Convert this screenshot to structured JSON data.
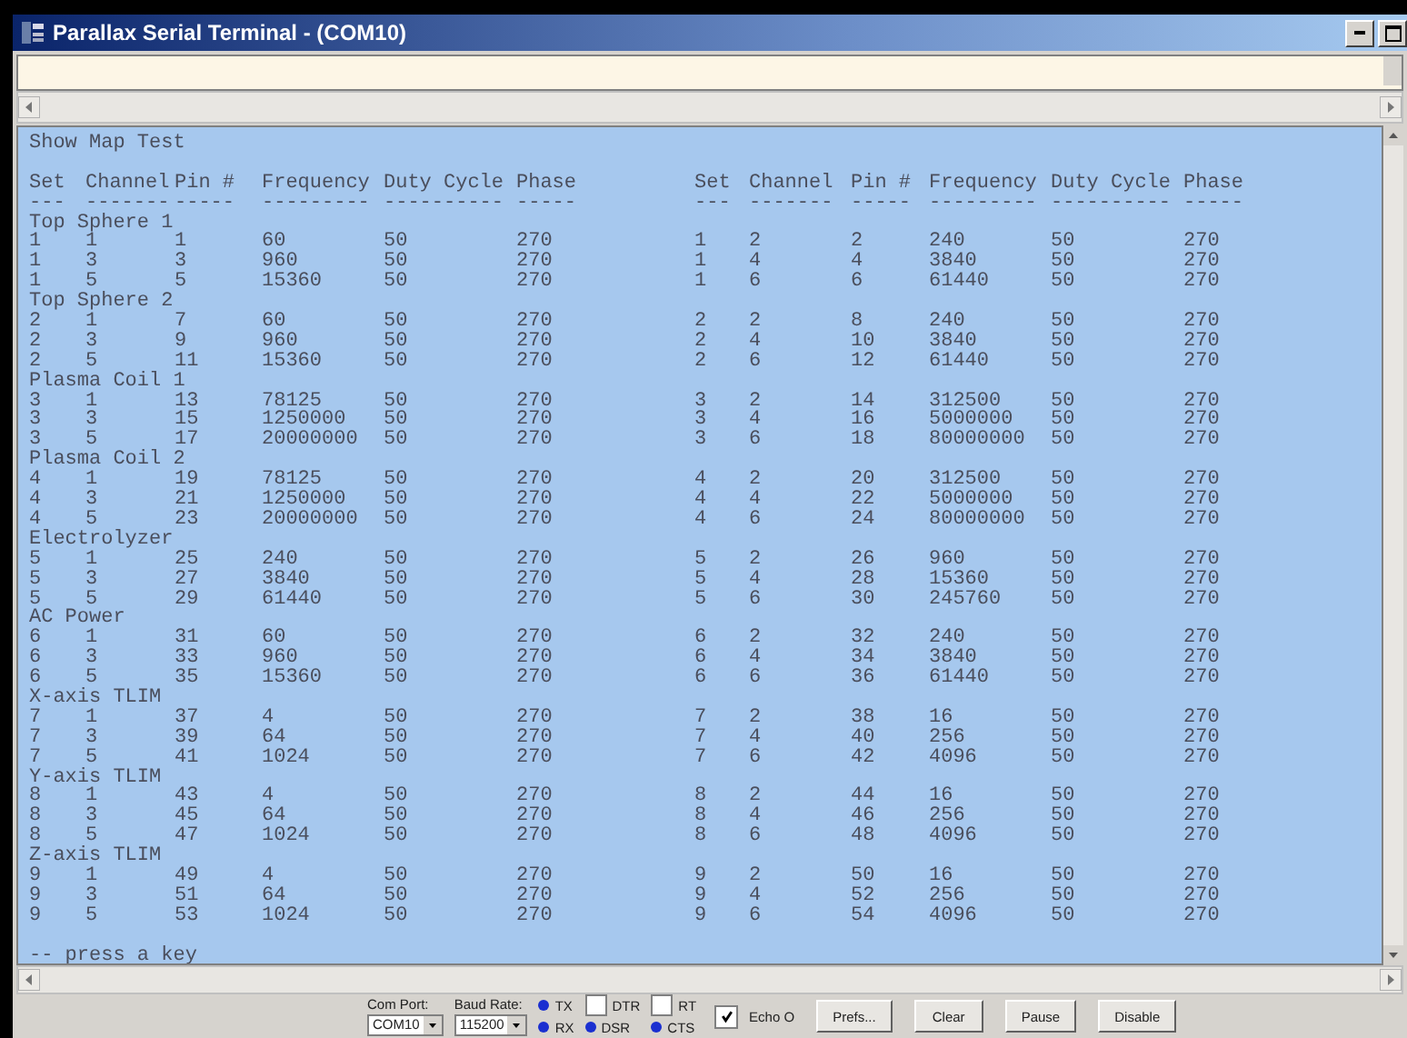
{
  "window": {
    "title": "Parallax Serial Terminal - (COM10)"
  },
  "terminal": {
    "heading": "Show Map Test",
    "columns": [
      "Set",
      "Channel",
      "Pin #",
      "Frequency",
      "Duty Cycle",
      "Phase",
      "Set",
      "Channel",
      "Pin #",
      "Frequency",
      "Duty Cycle",
      "Phase"
    ],
    "underlines": [
      "---",
      "-------",
      "-----",
      "---------",
      "----------",
      "-----",
      "---",
      "-------",
      "-----",
      "---------",
      "----------",
      "-----"
    ],
    "groups": [
      {
        "name": "Top Sphere 1",
        "rows": [
          [
            "1",
            "1",
            "1",
            "60",
            "50",
            "270",
            "1",
            "2",
            "2",
            "240",
            "50",
            "270"
          ],
          [
            "1",
            "3",
            "3",
            "960",
            "50",
            "270",
            "1",
            "4",
            "4",
            "3840",
            "50",
            "270"
          ],
          [
            "1",
            "5",
            "5",
            "15360",
            "50",
            "270",
            "1",
            "6",
            "6",
            "61440",
            "50",
            "270"
          ]
        ]
      },
      {
        "name": "Top Sphere 2",
        "rows": [
          [
            "2",
            "1",
            "7",
            "60",
            "50",
            "270",
            "2",
            "2",
            "8",
            "240",
            "50",
            "270"
          ],
          [
            "2",
            "3",
            "9",
            "960",
            "50",
            "270",
            "2",
            "4",
            "10",
            "3840",
            "50",
            "270"
          ],
          [
            "2",
            "5",
            "11",
            "15360",
            "50",
            "270",
            "2",
            "6",
            "12",
            "61440",
            "50",
            "270"
          ]
        ]
      },
      {
        "name": "Plasma Coil 1",
        "rows": [
          [
            "3",
            "1",
            "13",
            "78125",
            "50",
            "270",
            "3",
            "2",
            "14",
            "312500",
            "50",
            "270"
          ],
          [
            "3",
            "3",
            "15",
            "1250000",
            "50",
            "270",
            "3",
            "4",
            "16",
            "5000000",
            "50",
            "270"
          ],
          [
            "3",
            "5",
            "17",
            "20000000",
            "50",
            "270",
            "3",
            "6",
            "18",
            "80000000",
            "50",
            "270"
          ]
        ]
      },
      {
        "name": "Plasma Coil 2",
        "rows": [
          [
            "4",
            "1",
            "19",
            "78125",
            "50",
            "270",
            "4",
            "2",
            "20",
            "312500",
            "50",
            "270"
          ],
          [
            "4",
            "3",
            "21",
            "1250000",
            "50",
            "270",
            "4",
            "4",
            "22",
            "5000000",
            "50",
            "270"
          ],
          [
            "4",
            "5",
            "23",
            "20000000",
            "50",
            "270",
            "4",
            "6",
            "24",
            "80000000",
            "50",
            "270"
          ]
        ]
      },
      {
        "name": "Electrolyzer",
        "rows": [
          [
            "5",
            "1",
            "25",
            "240",
            "50",
            "270",
            "5",
            "2",
            "26",
            "960",
            "50",
            "270"
          ],
          [
            "5",
            "3",
            "27",
            "3840",
            "50",
            "270",
            "5",
            "4",
            "28",
            "15360",
            "50",
            "270"
          ],
          [
            "5",
            "5",
            "29",
            "61440",
            "50",
            "270",
            "5",
            "6",
            "30",
            "245760",
            "50",
            "270"
          ]
        ]
      },
      {
        "name": "AC Power",
        "rows": [
          [
            "6",
            "1",
            "31",
            "60",
            "50",
            "270",
            "6",
            "2",
            "32",
            "240",
            "50",
            "270"
          ],
          [
            "6",
            "3",
            "33",
            "960",
            "50",
            "270",
            "6",
            "4",
            "34",
            "3840",
            "50",
            "270"
          ],
          [
            "6",
            "5",
            "35",
            "15360",
            "50",
            "270",
            "6",
            "6",
            "36",
            "61440",
            "50",
            "270"
          ]
        ]
      },
      {
        "name": "X-axis TLIM",
        "rows": [
          [
            "7",
            "1",
            "37",
            "4",
            "50",
            "270",
            "7",
            "2",
            "38",
            "16",
            "50",
            "270"
          ],
          [
            "7",
            "3",
            "39",
            "64",
            "50",
            "270",
            "7",
            "4",
            "40",
            "256",
            "50",
            "270"
          ],
          [
            "7",
            "5",
            "41",
            "1024",
            "50",
            "270",
            "7",
            "6",
            "42",
            "4096",
            "50",
            "270"
          ]
        ]
      },
      {
        "name": "Y-axis TLIM",
        "rows": [
          [
            "8",
            "1",
            "43",
            "4",
            "50",
            "270",
            "8",
            "2",
            "44",
            "16",
            "50",
            "270"
          ],
          [
            "8",
            "3",
            "45",
            "64",
            "50",
            "270",
            "8",
            "4",
            "46",
            "256",
            "50",
            "270"
          ],
          [
            "8",
            "5",
            "47",
            "1024",
            "50",
            "270",
            "8",
            "6",
            "48",
            "4096",
            "50",
            "270"
          ]
        ]
      },
      {
        "name": "Z-axis TLIM",
        "rows": [
          [
            "9",
            "1",
            "49",
            "4",
            "50",
            "270",
            "9",
            "2",
            "50",
            "16",
            "50",
            "270"
          ],
          [
            "9",
            "3",
            "51",
            "64",
            "50",
            "270",
            "9",
            "4",
            "52",
            "256",
            "50",
            "270"
          ],
          [
            "9",
            "5",
            "53",
            "1024",
            "50",
            "270",
            "9",
            "6",
            "54",
            "4096",
            "50",
            "270"
          ]
        ]
      }
    ],
    "prompt": "-- press a key"
  },
  "toolbar": {
    "com_port": {
      "label": "Com Port:",
      "value": "COM10"
    },
    "baud_rate": {
      "label": "Baud Rate:",
      "value": "115200"
    },
    "signals": [
      {
        "top": {
          "kind": "led",
          "label": "TX"
        },
        "bottom": {
          "kind": "led",
          "label": "RX"
        }
      },
      {
        "top": {
          "kind": "checkbox",
          "label": "DTR",
          "checked": false
        },
        "bottom": {
          "kind": "led",
          "label": "DSR"
        }
      },
      {
        "top": {
          "kind": "checkbox",
          "label": "RT",
          "checked": false
        },
        "bottom": {
          "kind": "led",
          "label": "CTS"
        }
      }
    ],
    "echo": {
      "label": "Echo O",
      "checked": true
    },
    "buttons": [
      "Prefs...",
      "Clear",
      "Pause",
      "Disable"
    ]
  }
}
